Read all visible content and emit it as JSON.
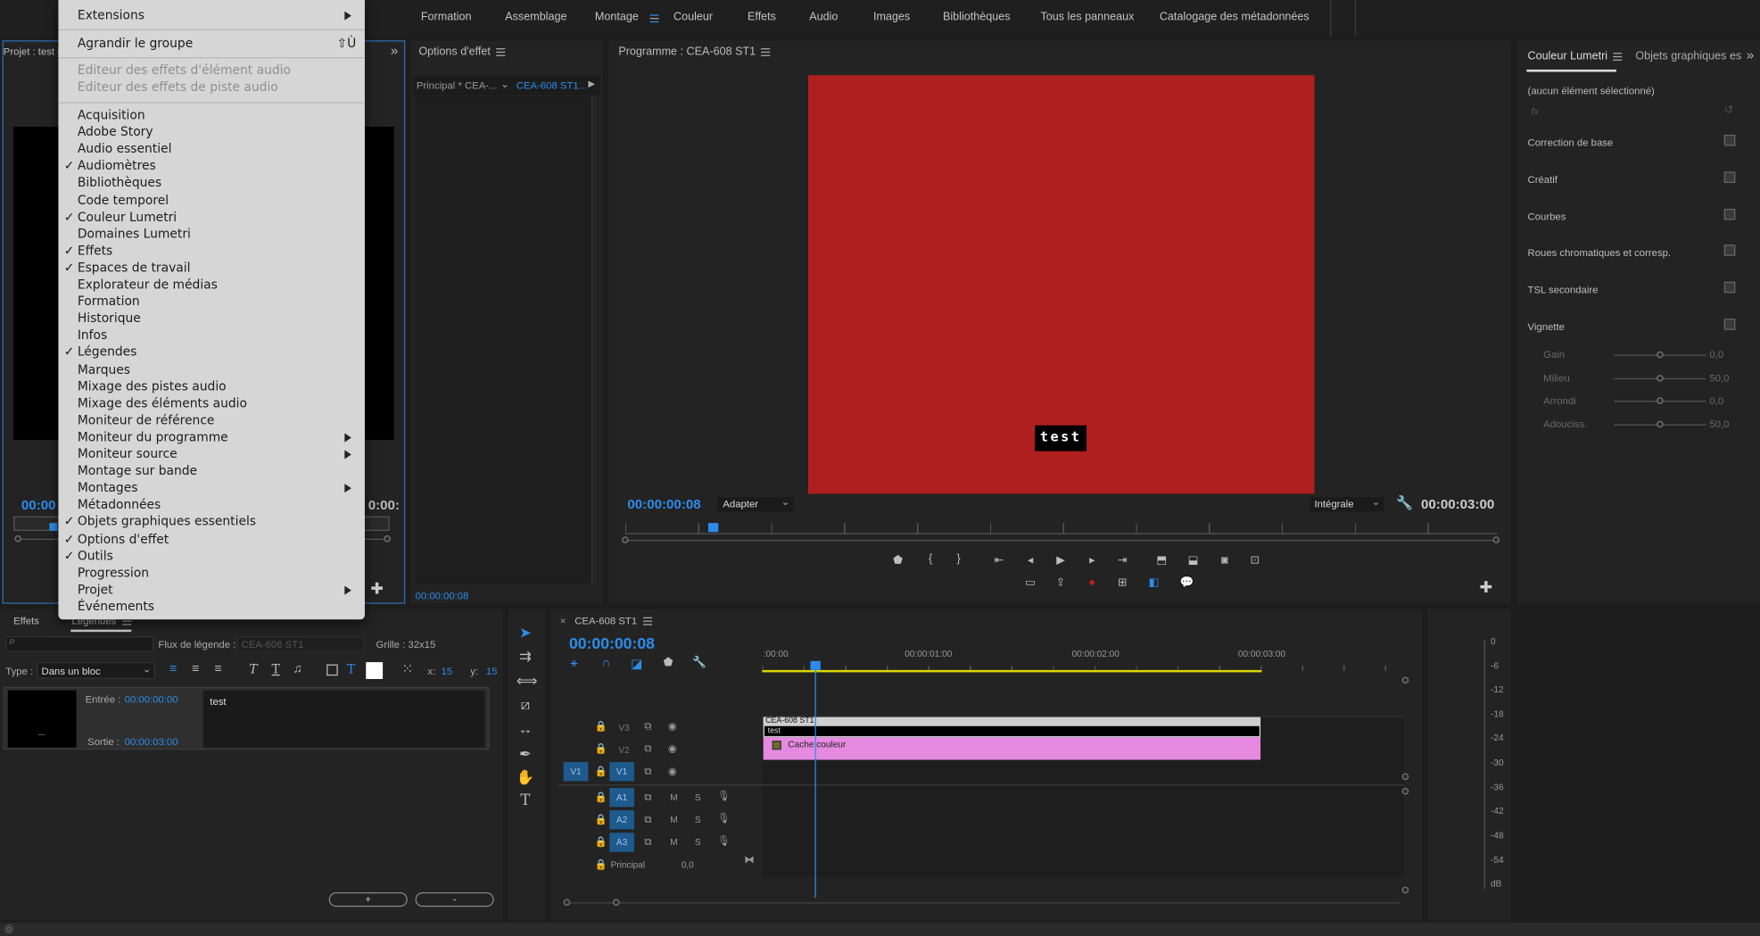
{
  "workspaces": {
    "items": [
      "Formation",
      "Assemblage",
      "Montage",
      "Couleur",
      "Effets",
      "Audio",
      "Images",
      "Bibliothèques",
      "Tous les panneaux",
      "Catalogage des métadonnées"
    ],
    "active": "Montage"
  },
  "window_menu": {
    "top": [
      "Extensions",
      "Agrandir le groupe"
    ],
    "shortcut": "⇧Ù",
    "disabled": [
      "Editeur des effets d'élément audio",
      "Editeur des effets de piste audio"
    ],
    "items": [
      {
        "label": "Acquisition",
        "checked": false
      },
      {
        "label": "Adobe Story",
        "checked": false
      },
      {
        "label": "Audio essentiel",
        "checked": false
      },
      {
        "label": "Audiomètres",
        "checked": true
      },
      {
        "label": "Bibliothèques",
        "checked": false
      },
      {
        "label": "Code temporel",
        "checked": false
      },
      {
        "label": "Couleur Lumetri",
        "checked": true
      },
      {
        "label": "Domaines Lumetri",
        "checked": false
      },
      {
        "label": "Effets",
        "checked": true
      },
      {
        "label": "Espaces de travail",
        "checked": true
      },
      {
        "label": "Explorateur de médias",
        "checked": false
      },
      {
        "label": "Formation",
        "checked": false
      },
      {
        "label": "Historique",
        "checked": false
      },
      {
        "label": "Infos",
        "checked": false
      },
      {
        "label": "Légendes",
        "checked": true
      },
      {
        "label": "Marques",
        "checked": false
      },
      {
        "label": "Mixage des pistes audio",
        "checked": false
      },
      {
        "label": "Mixage des éléments audio",
        "checked": false
      },
      {
        "label": "Moniteur de référence",
        "checked": false
      },
      {
        "label": "Moniteur du programme",
        "checked": false,
        "submenu": true
      },
      {
        "label": "Moniteur source",
        "checked": false,
        "submenu": true
      },
      {
        "label": "Montage sur bande",
        "checked": false
      },
      {
        "label": "Montages",
        "checked": false,
        "submenu": true
      },
      {
        "label": "Métadonnées",
        "checked": false
      },
      {
        "label": "Objets graphiques essentiels",
        "checked": true
      },
      {
        "label": "Options d'effet",
        "checked": true
      },
      {
        "label": "Outils",
        "checked": true
      },
      {
        "label": "Progression",
        "checked": false
      },
      {
        "label": "Projet",
        "checked": false,
        "submenu": true
      },
      {
        "label": "Événements",
        "checked": false
      }
    ]
  },
  "project": {
    "title": "Projet : test s",
    "tc_left": "00:00",
    "tc_right": "0:00:"
  },
  "effect_options": {
    "title": "Options d'effet",
    "tab_main": "Principal * CEA-...",
    "tab_seq": "CEA-608 ST1...",
    "timecode": "00:00:00:08"
  },
  "program": {
    "title": "Programme : CEA-608 ST1",
    "timecode": "00:00:00:08",
    "fit": "Adapter",
    "quality": "Intégrale",
    "duration": "00:00:03:00",
    "caption": "test",
    "frame_color": "#b01f1f"
  },
  "lumetri": {
    "tab": "Couleur Lumetri",
    "tab2": "Objets graphiques es",
    "no_selection": "(aucun élément sélectionné)",
    "fx": "fx",
    "sections": [
      "Correction de base",
      "Créatif",
      "Courbes",
      "Roues chromatiques et corresp.",
      "TSL secondaire",
      "Vignette"
    ],
    "vignette": [
      {
        "label": "Gain",
        "value": "0,0",
        "level": 0.5
      },
      {
        "label": "Milieu",
        "value": "50,0",
        "level": 0.5
      },
      {
        "label": "Arrondi",
        "value": "0,0",
        "level": 0.5
      },
      {
        "label": "Adouciss.",
        "value": "50,0",
        "level": 0.5
      }
    ]
  },
  "captions": {
    "tab_effects": "Effets",
    "tab_captions": "Légendes",
    "stream_label": "Flux de légende :",
    "stream_value": "CEA-608 ST1",
    "grid": "Grille : 32x15",
    "type_label": "Type :",
    "type_value": "Dans un bloc",
    "x_label": "x:",
    "x_value": "15",
    "y_label": "y:",
    "y_value": "15",
    "in_label": "Entrée :",
    "in_value": "00:00:00:00",
    "out_label": "Sortie :",
    "out_value": "00:00:03:00",
    "text": "test",
    "add": "+",
    "remove": "-",
    "thumb_mark": "—"
  },
  "timeline": {
    "title": "CEA-608 ST1",
    "timecode": "00:00:00:08",
    "ruler": [
      ":00:00",
      "00:00:01:00",
      "00:00:02:00",
      "00:00:03:00"
    ],
    "video_tracks": [
      "V3",
      "V2",
      "V1"
    ],
    "audio_tracks": [
      "A1",
      "A2",
      "A3"
    ],
    "src_patch": "V1",
    "m": "M",
    "s": "S",
    "master": "Principal",
    "master_value": "0,0",
    "clip_caption_name": "CEA-608 ST1",
    "clip_caption_text": "test",
    "clip_color_name": "Cache couleur",
    "clip_color": "#e58ae0"
  },
  "meter": {
    "scale": [
      "0",
      "-6",
      "-12",
      "-18",
      "-24",
      "-30",
      "-36",
      "-42",
      "-48",
      "-54",
      "dB"
    ]
  }
}
